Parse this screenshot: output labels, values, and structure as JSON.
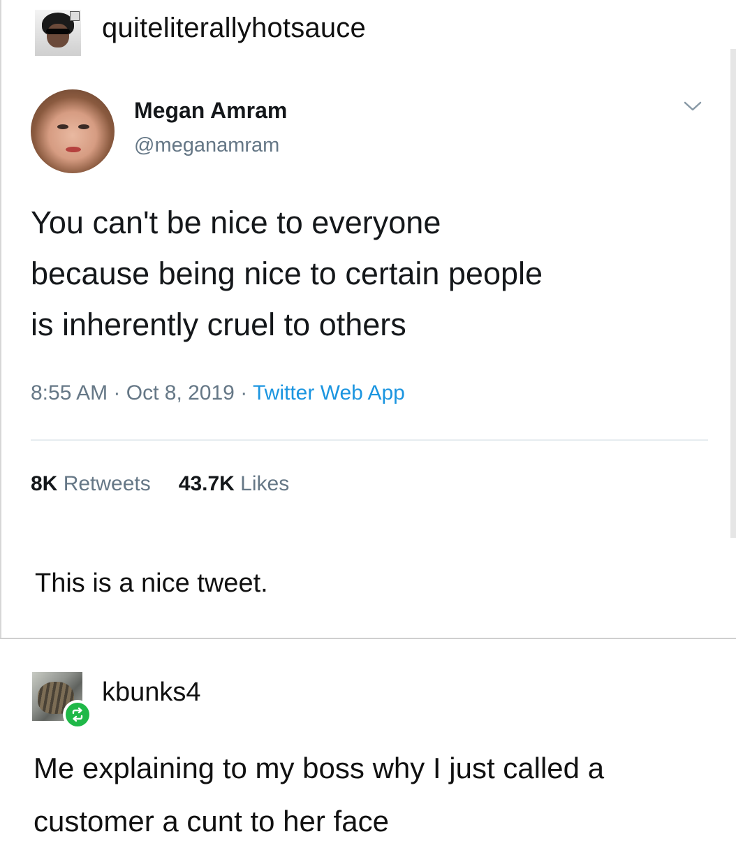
{
  "post": {
    "blog_name": "quiteliterallyhotsauce",
    "tweet": {
      "display_name": "Megan Amram",
      "handle": "@meganamram",
      "text_lines": [
        "You can't be nice to everyone",
        "because being nice to certain people",
        "is inherently cruel to others"
      ],
      "time": "8:55 AM",
      "separator": " · ",
      "date": "Oct 8, 2019",
      "source": "Twitter Web App",
      "retweets_count": "8K",
      "retweets_label": "Retweets",
      "likes_count": "43.7K",
      "likes_label": "Likes"
    },
    "comment": "This is a nice tweet."
  },
  "reblog": {
    "blog_name": "kbunks4",
    "comment_lines": [
      "Me explaining to my boss why I just called a",
      "customer a cunt to her face"
    ]
  },
  "icons": {
    "menu": "chevron-down-icon",
    "reblog": "reblog-icon"
  },
  "colors": {
    "twitter_blue": "#1b95e0",
    "twitter_gray": "#657786",
    "reblog_green": "#1fb848"
  }
}
